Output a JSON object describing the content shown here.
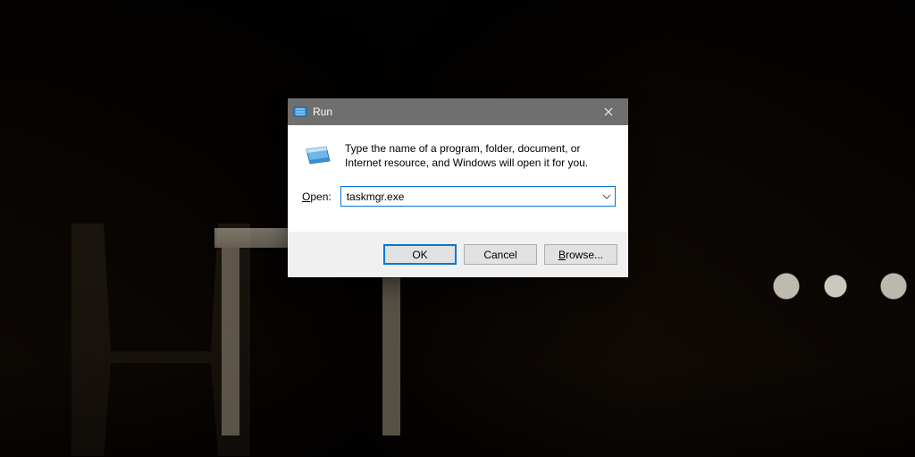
{
  "dialog": {
    "title": "Run",
    "description": "Type the name of a program, folder, document, or Internet resource, and Windows will open it for you.",
    "open_label_prefix": "O",
    "open_label_rest": "pen:",
    "input_value": "taskmgr.exe",
    "buttons": {
      "ok": "OK",
      "cancel": "Cancel",
      "browse_prefix": "B",
      "browse_rest": "rowse..."
    }
  }
}
